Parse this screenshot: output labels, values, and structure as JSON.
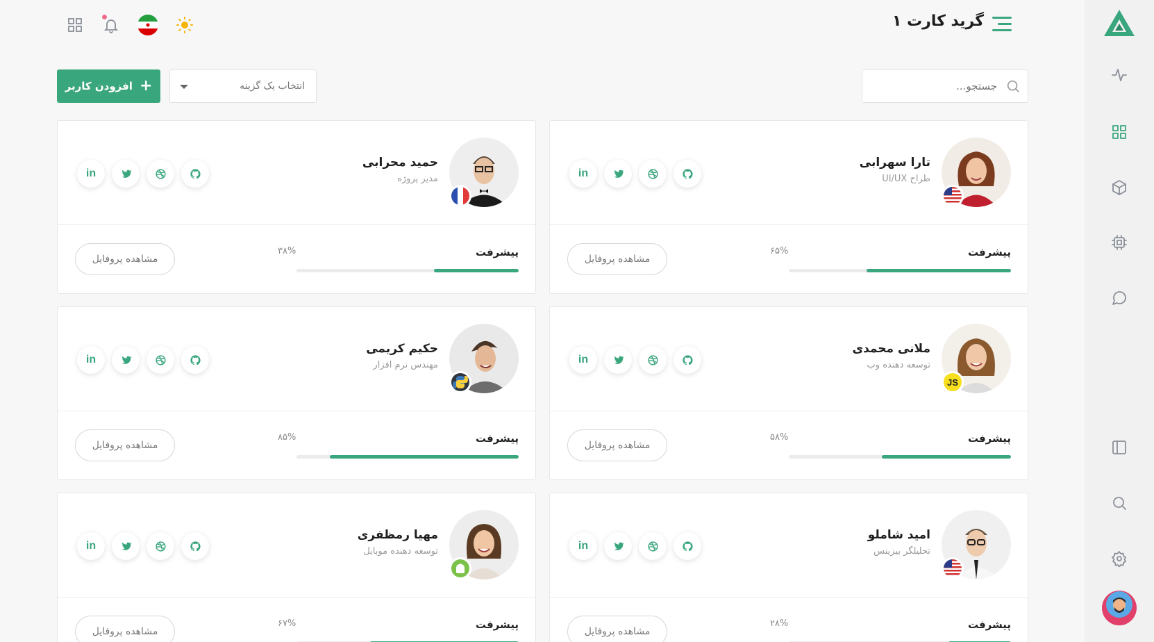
{
  "header": {
    "title": "گرید کارت ۱",
    "icons": [
      "menu-icon",
      "theme-sun-icon",
      "iran-flag-icon",
      "bell-icon",
      "apps-grid-icon"
    ],
    "accent": "#3aa67d"
  },
  "toolbar": {
    "search_placeholder": "جستجو...",
    "select_value": "انتخاب یک گزینه",
    "add_user_label": "افزودن کاربر"
  },
  "sidebar": {
    "items": [
      "logo",
      "activity-icon",
      "grid-icon",
      "cube-icon",
      "chip-icon",
      "chat-icon",
      "sidebar-layout-icon",
      "search-icon",
      "settings-icon",
      "user-avatar"
    ],
    "active": "grid-icon"
  },
  "cards": [
    {
      "name": "تارا سهرابی",
      "role": "طراح UI/UX",
      "badge": "us-flag",
      "progress_label": "پیشرفت",
      "progress_text": "۶۵%",
      "progress": 65,
      "button": "مشاهده پروفایل"
    },
    {
      "name": "حمید محرابی",
      "role": "مدیر پروژه",
      "badge": "fr-flag",
      "progress_label": "پیشرفت",
      "progress_text": "۳۸%",
      "progress": 38,
      "button": "مشاهده پروفایل"
    },
    {
      "name": "ملانی محمدی",
      "role": "توسعه دهنده وب",
      "badge": "js",
      "progress_label": "پیشرفت",
      "progress_text": "۵۸%",
      "progress": 58,
      "button": "مشاهده پروفایل"
    },
    {
      "name": "حکیم کریمی",
      "role": "مهندس نرم افزار",
      "badge": "python",
      "progress_label": "پیشرفت",
      "progress_text": "۸۵%",
      "progress": 85,
      "button": "مشاهده پروفایل"
    },
    {
      "name": "امید شاملو",
      "role": "تحلیلگر بیزینس",
      "badge": "us-flag",
      "progress_label": "پیشرفت",
      "progress_text": "۲۸%",
      "progress": 28,
      "button": "مشاهده پروفایل"
    },
    {
      "name": "مهیا رمظفری",
      "role": "توسعه دهنده موبایل",
      "badge": "android",
      "progress_label": "پیشرفت",
      "progress_text": "۶۷%",
      "progress": 67,
      "button": "مشاهده پروفایل"
    }
  ],
  "social_icons": [
    "linkedin-icon",
    "twitter-icon",
    "dribbble-icon",
    "github-icon"
  ],
  "badges": {
    "js_text": "JS"
  }
}
